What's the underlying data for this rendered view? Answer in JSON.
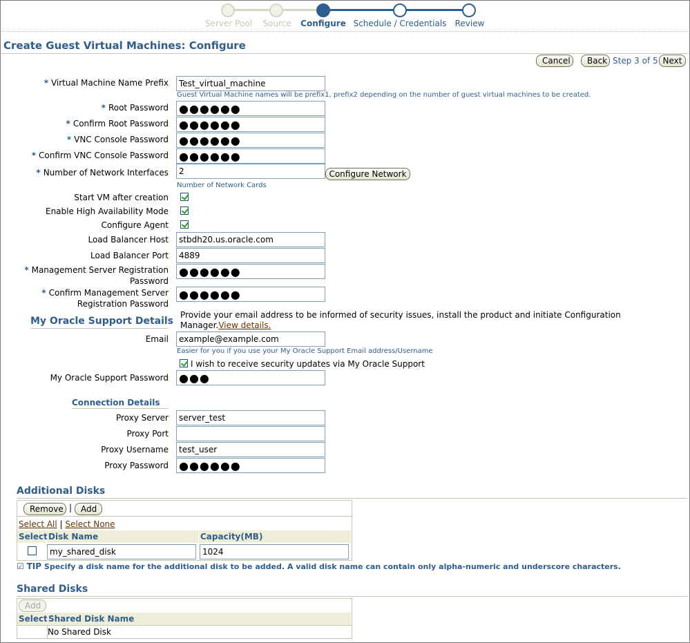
{
  "train": {
    "steps": [
      {
        "label": "Server Pool",
        "state": "done"
      },
      {
        "label": "Source",
        "state": "done"
      },
      {
        "label": "Configure",
        "state": "current"
      },
      {
        "label": "Schedule / Credentials",
        "state": "next"
      },
      {
        "label": "Review",
        "state": "next"
      }
    ]
  },
  "page_title": "Create Guest Virtual Machines: Configure",
  "nav": {
    "cancel": "Cancel",
    "back": "Back",
    "step_text": "Step 3 of 5",
    "next": "Next"
  },
  "form": {
    "vm_prefix": {
      "label": "Virtual Machine Name Prefix",
      "value": "Test_virtual_machine",
      "hint": "Guest Virtual Machine names will be prefix1, prefix2 depending on the number of guest virtual machines to be created."
    },
    "root_password": {
      "label": "Root Password",
      "value": "●●●●●●"
    },
    "confirm_root_password": {
      "label": "Confirm Root Password",
      "value": "●●●●●●"
    },
    "vnc_password": {
      "label": "VNC Console Password",
      "value": "●●●●●●"
    },
    "confirm_vnc_password": {
      "label": "Confirm VNC Console Password",
      "value": "●●●●●●"
    },
    "network_interfaces": {
      "label": "Number of Network Interfaces",
      "value": "2",
      "button": "Configure Network",
      "hint": "Number of Network Cards"
    },
    "start_vm": {
      "label": "Start VM after creation",
      "checked": true
    },
    "high_availability": {
      "label": "Enable High Availability Mode",
      "checked": true
    },
    "configure_agent": {
      "label": "Configure Agent",
      "checked": true
    },
    "lb_host": {
      "label": "Load Balancer Host",
      "value": "stbdh20.us.oracle.com"
    },
    "lb_port": {
      "label": "Load Balancer Port",
      "value": "4889"
    },
    "mgmt_password": {
      "label": "Management Server Registration Password",
      "value": "●●●●●●"
    },
    "confirm_mgmt_password": {
      "label": "Confirm Management Server Registration Password",
      "value": "●●●●●●"
    }
  },
  "support": {
    "heading": "My Oracle Support Details",
    "intro": "Provide your email address to be informed of security issues, install the product and initiate Configuration Manager.",
    "intro_link": "View details.",
    "email": {
      "label": "Email",
      "value": "example@example.com",
      "hint": "Easier for you if you use your My Oracle Support Email address/Username"
    },
    "updates_checkbox": {
      "label": "I wish to receive security updates via My Oracle Support",
      "checked": true
    },
    "password": {
      "label": "My Oracle Support Password",
      "value": "●●●"
    }
  },
  "connection": {
    "heading": "Connection Details",
    "proxy_server": {
      "label": "Proxy Server",
      "value": "server_test"
    },
    "proxy_port": {
      "label": "Proxy Port",
      "value": ""
    },
    "proxy_username": {
      "label": "Proxy Username",
      "value": "test_user"
    },
    "proxy_password": {
      "label": "Proxy Password",
      "value": "●●●●●●"
    }
  },
  "additional_disks": {
    "heading": "Additional Disks",
    "remove": "Remove",
    "separator": "|",
    "add": "Add",
    "select_all": "Select All",
    "select_none": "Select None",
    "columns": [
      "Select",
      "Disk Name",
      "Capacity(MB)"
    ],
    "rows": [
      {
        "selected": false,
        "name": "my_shared_disk",
        "capacity": "1024"
      }
    ],
    "tip_label": "TIP",
    "tip": "Specify a disk name for the additional disk to be added. A valid disk name can contain only alpha-numeric and underscore characters."
  },
  "shared_disks": {
    "heading": "Shared Disks",
    "add": "Add",
    "columns": [
      "Select",
      "Shared Disk Name"
    ],
    "empty": "No Shared Disk"
  },
  "colors": {
    "accent": "#2f5d8e",
    "header_bg": "#eeeed8",
    "link": "#663300"
  }
}
